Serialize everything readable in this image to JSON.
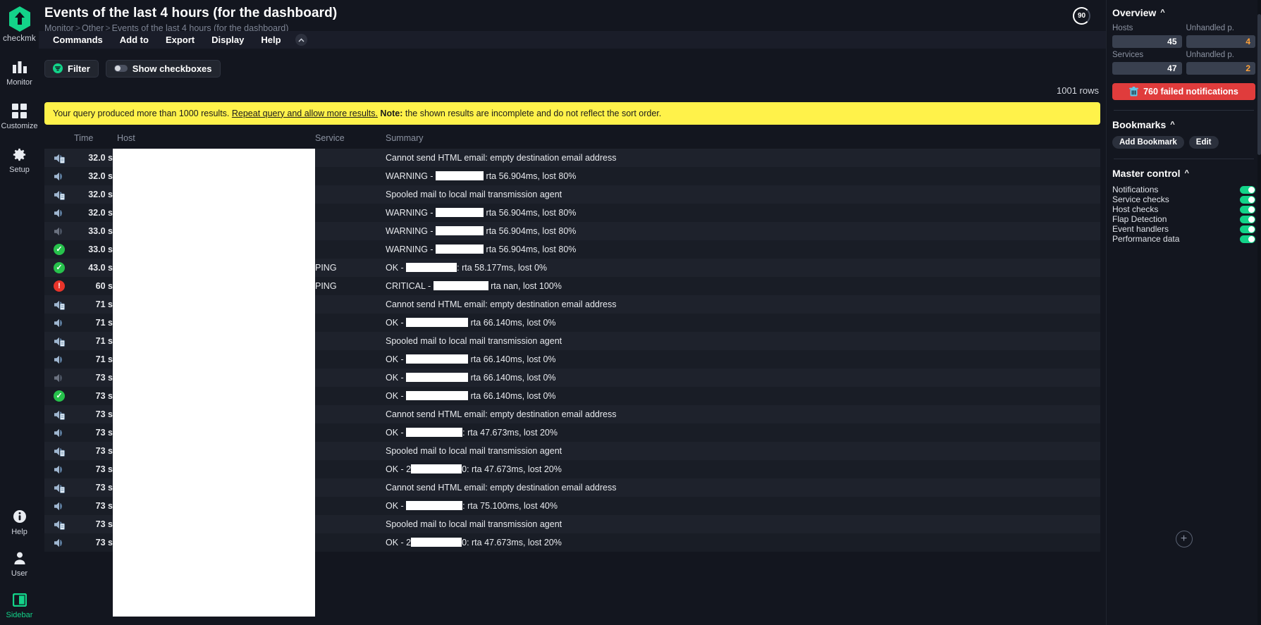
{
  "nav": {
    "logo_text": "checkmk",
    "items": [
      {
        "label": "Monitor",
        "icon": "bar-chart-icon"
      },
      {
        "label": "Customize",
        "icon": "grid-squares-icon"
      },
      {
        "label": "Setup",
        "icon": "gear-icon"
      }
    ],
    "bottom_items": [
      {
        "label": "Help",
        "icon": "info-circle-icon"
      },
      {
        "label": "User",
        "icon": "user-icon"
      },
      {
        "label": "Sidebar",
        "icon": "sidebar-panel-icon"
      }
    ]
  },
  "header": {
    "title": "Events of the last 4 hours (for the dashboard)",
    "breadcrumb": [
      "Monitor",
      "Other",
      "Events of the last 4 hours (for the dashboard)"
    ],
    "reload_seconds": "90"
  },
  "menubar": {
    "items": [
      "Commands",
      "Add to",
      "Export",
      "Display",
      "Help"
    ],
    "collapse_icon": "chevron-up-icon"
  },
  "toolbar": {
    "filter_label": "Filter",
    "filter_icon": "filter-funnel-icon",
    "checkboxes_label": "Show checkboxes",
    "checkboxes_on": false
  },
  "rowcount": "1001 rows",
  "warning": {
    "text_before": "Your query produced more than 1000 results.",
    "link": "Repeat query and allow more results.",
    "note_label": "Note:",
    "text_after": "the shown results are incomplete and do not reflect the sort order."
  },
  "table": {
    "columns": [
      "",
      "Time",
      "Host",
      "Service",
      "Summary"
    ],
    "rows": [
      {
        "icon": "notification-log-icon",
        "time": "32.0 s",
        "host": "",
        "service": "",
        "summary": "Cannot send HTML email: empty destination email address",
        "redact": null
      },
      {
        "icon": "alert-speaker-icon",
        "time": "32.0 s",
        "host": "",
        "service": "",
        "summary_pre": "WARNING - ",
        "summary_post": " rta 56.904ms, lost 80%",
        "redact": 68
      },
      {
        "icon": "notification-log-icon",
        "time": "32.0 s",
        "host": "",
        "service": "",
        "summary": "Spooled mail to local mail transmission agent",
        "redact": null
      },
      {
        "icon": "alert-speaker-icon",
        "time": "32.0 s",
        "host": "",
        "service": "",
        "summary_pre": "WARNING - ",
        "summary_post": " rta 56.904ms, lost 80%",
        "redact": 68
      },
      {
        "icon": "alert-speaker-dim-icon",
        "time": "33.0 s",
        "host": "",
        "service": "",
        "summary_pre": "WARNING - ",
        "summary_post": " rta 56.904ms, lost 80%",
        "redact": 68
      },
      {
        "icon": "ok-check-icon",
        "time": "33.0 s",
        "host": "",
        "service": "",
        "summary_pre": "WARNING - ",
        "summary_post": " rta 56.904ms, lost 80%",
        "redact": 68
      },
      {
        "icon": "ok-check-icon",
        "time": "43.0 s",
        "host": "",
        "service": "PING",
        "summary_pre": "OK - ",
        "summary_post": ": rta 58.177ms, lost 0%",
        "redact": 72
      },
      {
        "icon": "critical-alert-icon",
        "time": "60 s",
        "host": "",
        "service": "PING",
        "summary_pre": "CRITICAL - ",
        "summary_post": " rta nan, lost 100%",
        "redact": 78
      },
      {
        "icon": "notification-log-icon",
        "time": "71 s",
        "host": "",
        "service": "",
        "summary": "Cannot send HTML email: empty destination email address",
        "redact": null
      },
      {
        "icon": "alert-speaker-icon",
        "time": "71 s",
        "host": "",
        "service": "",
        "summary_pre": "OK - ",
        "summary_post": " rta 66.140ms, lost 0%",
        "redact": 88
      },
      {
        "icon": "notification-log-icon",
        "time": "71 s",
        "host": "",
        "service": "",
        "summary": "Spooled mail to local mail transmission agent",
        "redact": null
      },
      {
        "icon": "alert-speaker-icon",
        "time": "71 s",
        "host": "",
        "service": "",
        "summary_pre": "OK - ",
        "summary_post": " rta 66.140ms, lost 0%",
        "redact": 88
      },
      {
        "icon": "alert-speaker-dim-icon",
        "time": "73 s",
        "host": "",
        "service": "",
        "summary_pre": "OK - ",
        "summary_post": " rta 66.140ms, lost 0%",
        "redact": 88
      },
      {
        "icon": "ok-check-icon",
        "time": "73 s",
        "host": "",
        "service": "",
        "summary_pre": "OK - ",
        "summary_post": " rta 66.140ms, lost 0%",
        "redact": 88
      },
      {
        "icon": "notification-log-icon",
        "time": "73 s",
        "host": "",
        "service": "",
        "summary": "Cannot send HTML email: empty destination email address",
        "redact": null
      },
      {
        "icon": "alert-speaker-icon",
        "time": "73 s",
        "host": "",
        "service": "",
        "summary_pre": "OK - ",
        "summary_post": ": rta 47.673ms, lost 20%",
        "redact": 80
      },
      {
        "icon": "notification-log-icon",
        "time": "73 s",
        "host": "",
        "service": "",
        "summary": "Spooled mail to local mail transmission agent",
        "redact": null
      },
      {
        "icon": "alert-speaker-icon",
        "time": "73 s",
        "host": "",
        "service": "",
        "summary_pre": "OK - 2",
        "summary_post": "0: rta 47.673ms, lost 20%",
        "redact": 72
      },
      {
        "icon": "notification-log-icon",
        "time": "73 s",
        "host": "",
        "service": "",
        "summary": "Cannot send HTML email: empty destination email address",
        "redact": null
      },
      {
        "icon": "alert-speaker-icon",
        "time": "73 s",
        "host": "",
        "service": "",
        "summary_pre": "OK - ",
        "summary_post": ": rta 75.100ms, lost 40%",
        "redact": 80
      },
      {
        "icon": "notification-log-icon",
        "time": "73 s",
        "host": "",
        "service": "",
        "summary": "Spooled mail to local mail transmission agent",
        "redact": null
      },
      {
        "icon": "alert-speaker-icon",
        "time": "73 s",
        "host": "",
        "service": "",
        "summary_pre": "OK - 2",
        "summary_post": "0: rta 47.673ms, lost 20%",
        "redact": 72
      }
    ]
  },
  "sidebar": {
    "overview": {
      "title": "Overview",
      "hosts_label": "Hosts",
      "hosts_value": "45",
      "hosts_unhandled_label": "Unhandled p.",
      "hosts_unhandled_value": "4",
      "services_label": "Services",
      "services_value": "47",
      "services_unhandled_label": "Unhandled p.",
      "services_unhandled_value": "2",
      "failed_notifications": "760 failed notifications",
      "failed_icon": "trash-icon"
    },
    "bookmarks": {
      "title": "Bookmarks",
      "add_label": "Add Bookmark",
      "edit_label": "Edit"
    },
    "master_control": {
      "title": "Master control",
      "toggles": [
        {
          "label": "Notifications",
          "on": true
        },
        {
          "label": "Service checks",
          "on": true
        },
        {
          "label": "Host checks",
          "on": true
        },
        {
          "label": "Flap Detection",
          "on": true
        },
        {
          "label": "Event handlers",
          "on": true
        },
        {
          "label": "Performance data",
          "on": true
        }
      ]
    },
    "add_widget_icon": "plus-circle-icon"
  },
  "colors": {
    "accent_green": "#13d389",
    "warning_yellow": "#fff24a",
    "critical_red": "#e8342a",
    "ok_green": "#27c24c",
    "danger_button": "#e03c3c",
    "unhandled_orange": "#ffa23b"
  }
}
